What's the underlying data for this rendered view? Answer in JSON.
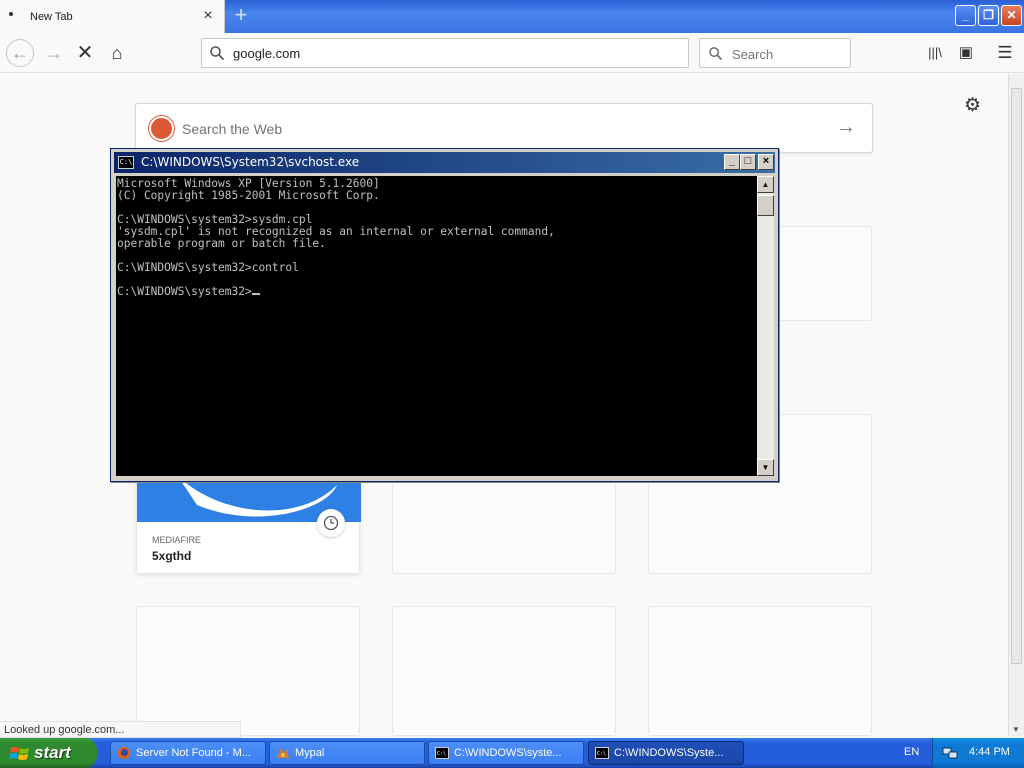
{
  "browser": {
    "tab_title": "New Tab",
    "tab_close_glyph": "×",
    "new_tab_glyph": "+",
    "url": "google.com",
    "search_placeholder": "Search",
    "status_text": "Looked up google.com...",
    "window_controls": {
      "minimize": "_",
      "maximize": "❐",
      "close": "✕"
    },
    "nav_icons": {
      "back": "←",
      "forward": "→",
      "stop": "✕",
      "home": "⌂",
      "library": "|||\\",
      "sidebar": "▣",
      "menu": "☰"
    }
  },
  "newtab": {
    "web_search_placeholder": "Search the Web",
    "web_search_go": "→",
    "settings_glyph": "⚙",
    "top_site": {
      "host": "MEDIAFIRE",
      "title": "5xgthd"
    }
  },
  "console": {
    "title": "C:\\WINDOWS\\System32\\svchost.exe",
    "icon_text": "C:\\",
    "controls": {
      "minimize": "_",
      "maximize": "□",
      "close": "×"
    },
    "scroll_up": "▲",
    "scroll_down": "▼",
    "lines": [
      "Microsoft Windows XP [Version 5.1.2600]",
      "(C) Copyright 1985-2001 Microsoft Corp.",
      "",
      "C:\\WINDOWS\\system32>sysdm.cpl",
      "'sysdm.cpl' is not recognized as an internal or external command,",
      "operable program or batch file.",
      "",
      "C:\\WINDOWS\\system32>control",
      "",
      "C:\\WINDOWS\\system32>"
    ]
  },
  "taskbar": {
    "start_label": "start",
    "tasks": [
      {
        "label": "Server Not Found - M...",
        "icon": "firefox-icon"
      },
      {
        "label": "Mypal",
        "icon": "mypal-icon"
      },
      {
        "label": "C:\\WINDOWS\\syste...",
        "icon": "console-icon"
      },
      {
        "label": "C:\\WINDOWS\\Syste...",
        "icon": "console-icon"
      }
    ],
    "language": "EN",
    "clock": "4:44 PM"
  },
  "colors": {
    "xp_blue": "#245edb",
    "start_green": "#2f8a2f",
    "console_title": "#0a246a",
    "mediafire_blue": "#2e80e5",
    "duckduckgo_orange": "#de5833"
  }
}
